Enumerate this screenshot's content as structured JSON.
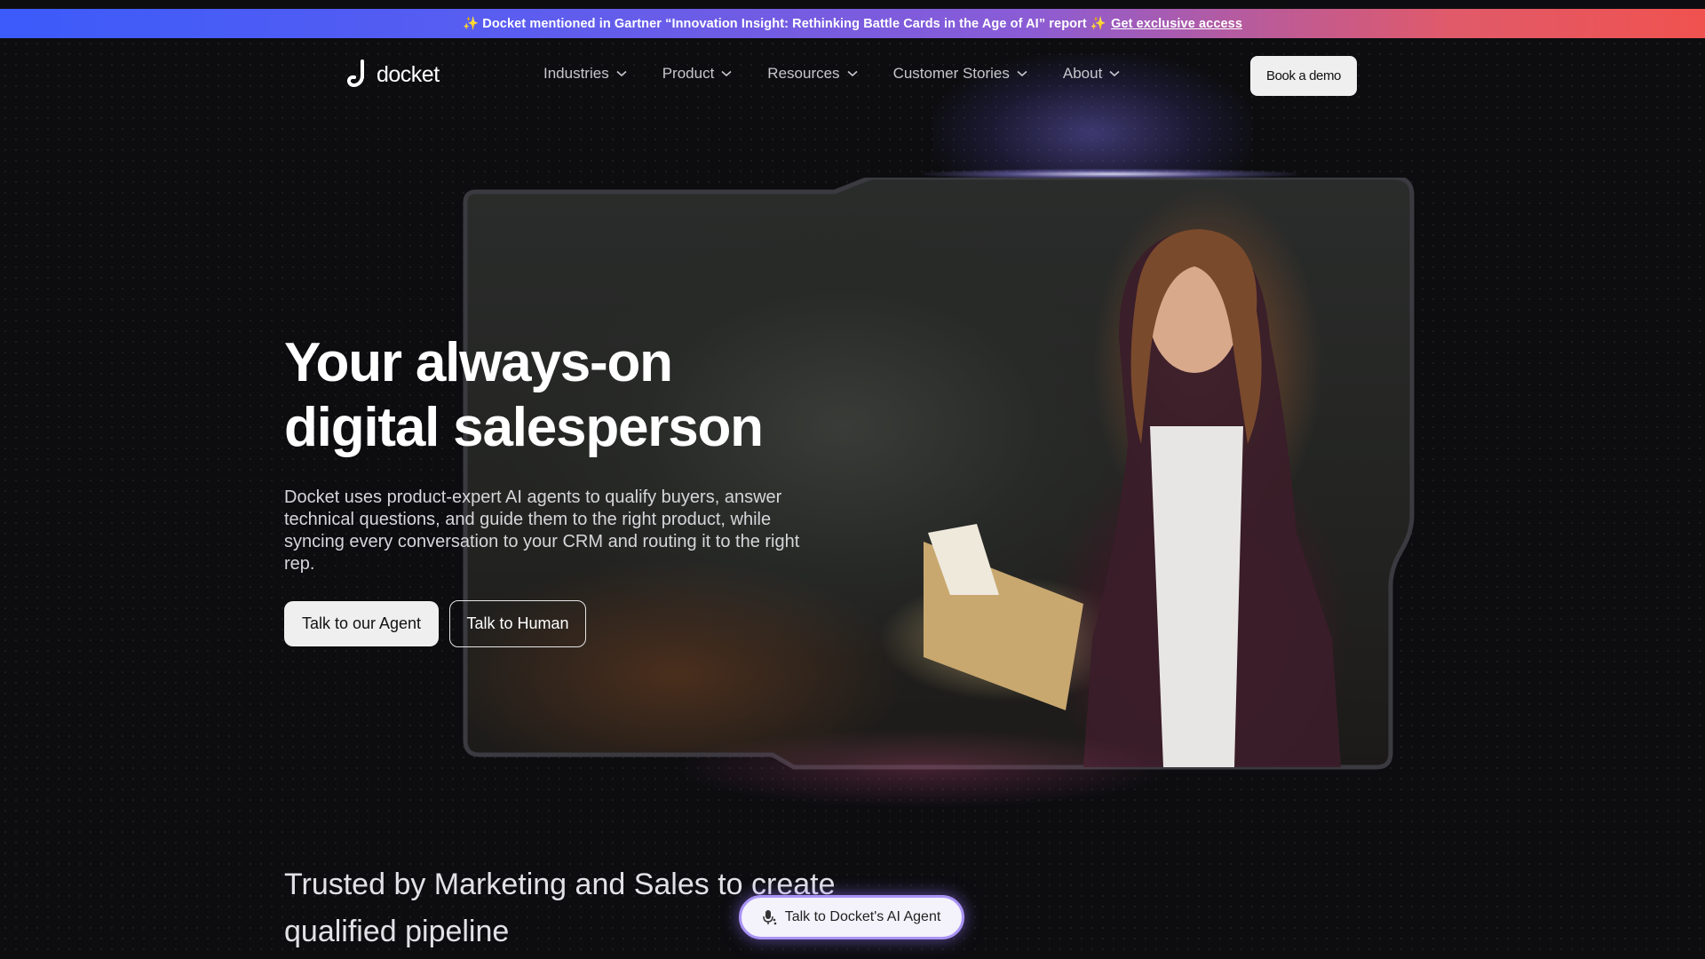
{
  "banner": {
    "text": "✨ Docket mentioned in Gartner “Innovation Insight: Rethinking Battle Cards in the Age of AI” report ✨",
    "link": "Get exclusive access"
  },
  "nav": {
    "logo_text": "docket",
    "menu": [
      {
        "label": "Industries"
      },
      {
        "label": "Product"
      },
      {
        "label": "Resources"
      },
      {
        "label": "Customer Stories"
      },
      {
        "label": "About"
      }
    ],
    "cta": "Book a demo"
  },
  "hero": {
    "headline_line1": "Your always-on",
    "headline_line2": "digital salesperson",
    "subcopy": "Docket uses product-expert AI agents to qualify buyers, answer technical questions, and guide them to the right product, while syncing every conversation to your CRM and routing it to the right rep.",
    "primary_button": "Talk to our Agent",
    "secondary_button": "Talk to Human"
  },
  "trusted": {
    "line1": "Trusted by Marketing and Sales to create",
    "line2": "qualified pipeline"
  },
  "agent_widget": {
    "label": "Talk to Docket's AI Agent",
    "icon": "microphone-icon"
  },
  "colors": {
    "background": "#0d0d10",
    "banner_start": "#3b5bfa",
    "banner_end": "#f0524f",
    "pill_border": "#a993f5"
  }
}
